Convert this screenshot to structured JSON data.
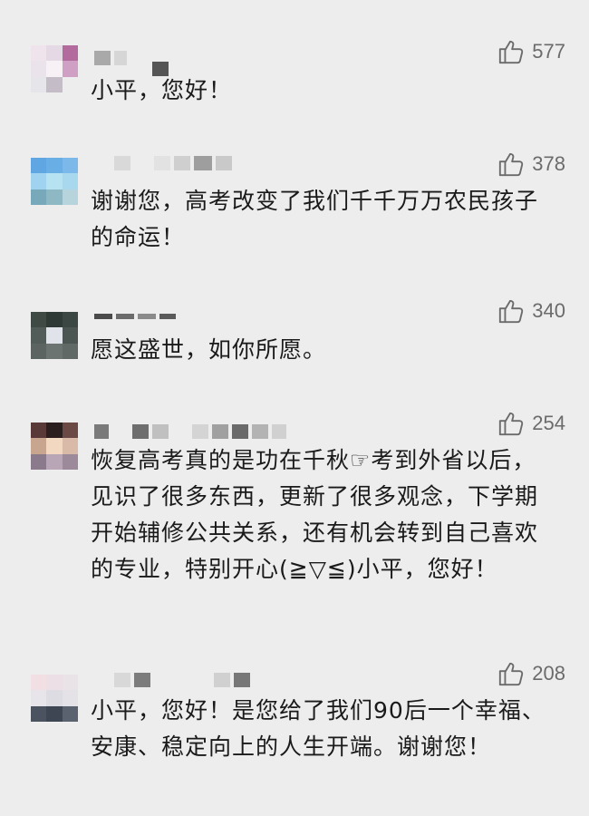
{
  "comments": [
    {
      "likes": "577",
      "text": "小平，您好！"
    },
    {
      "likes": "378",
      "text": "谢谢您，高考改变了我们千千万万农民孩子的命运！"
    },
    {
      "likes": "340",
      "text": "愿这盛世，如你所愿。"
    },
    {
      "likes": "254",
      "text": "恢复高考真的是功在千秋☞考到外省以后，见识了很多东西，更新了很多观念，下学期开始辅修公共关系，还有机会转到自己喜欢的专业，特别开心(≧▽≦)小平，您好！"
    },
    {
      "likes": "208",
      "text": "小平，您好！是您给了我们90后一个幸福、安康、稳定向上的人生开端。谢谢您！"
    }
  ],
  "icons": {
    "like": "thumbs-up-icon"
  },
  "colors": {
    "background": "#ededed",
    "text": "#1a1a1a",
    "like": "#6b6b6b"
  }
}
